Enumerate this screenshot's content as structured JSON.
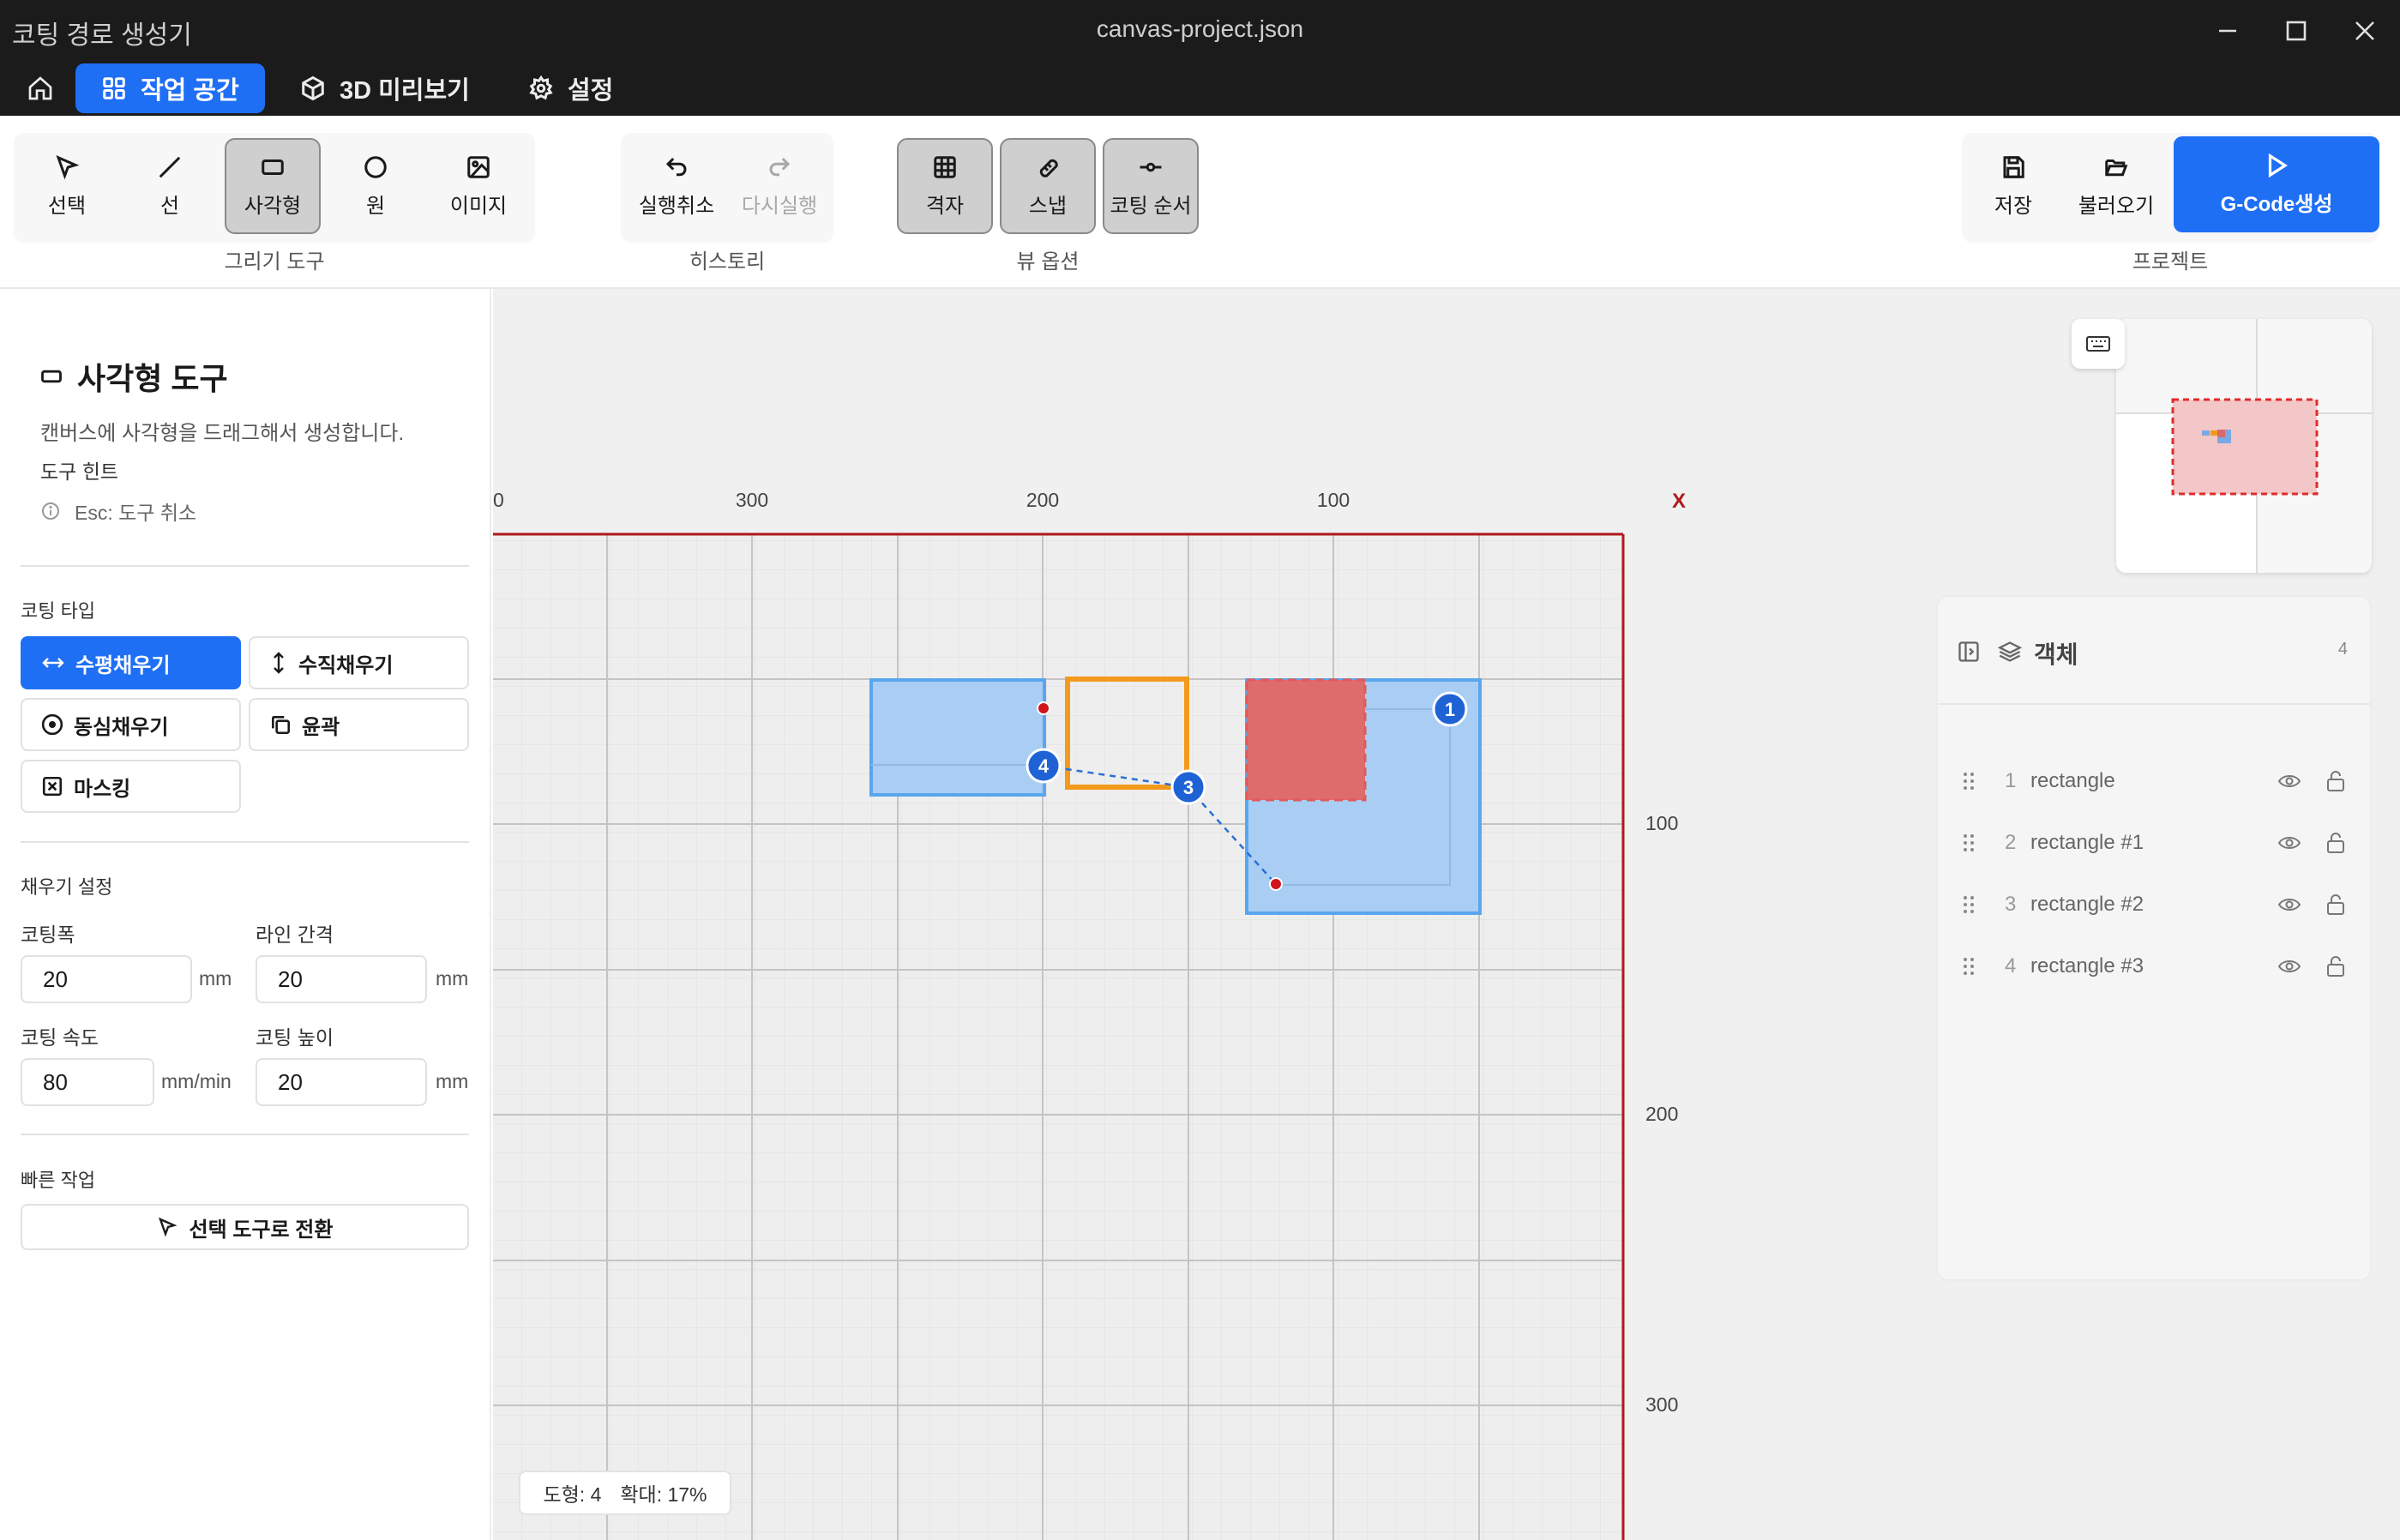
{
  "window": {
    "app_title": "코팅 경로 생성기",
    "file_title": "canvas-project.json"
  },
  "nav": {
    "tabs": [
      {
        "label": "작업 공간",
        "icon": "grid-icon",
        "active": true
      },
      {
        "label": "3D 미리보기",
        "icon": "cube-icon",
        "active": false
      },
      {
        "label": "설정",
        "icon": "gear-icon",
        "active": false
      }
    ]
  },
  "toolbar": {
    "draw_tools": {
      "group_label": "그리기 도구",
      "select": "선택",
      "line": "선",
      "rectangle": "사각형",
      "circle": "원",
      "image": "이미지"
    },
    "history": {
      "group_label": "히스토리",
      "undo": "실행취소",
      "redo": "다시실행"
    },
    "view": {
      "group_label": "뷰 옵션",
      "grid": "격자",
      "snap": "스냅",
      "order": "코팅 순서"
    },
    "project": {
      "group_label": "프로젝트",
      "save": "저장",
      "load": "불러오기",
      "gcode": "G-Code생성"
    }
  },
  "left_panel": {
    "title": "사각형 도구",
    "description": "캔버스에 사각형을 드래그해서 생성합니다.",
    "hint_title": "도구 힌트",
    "hint": "Esc: 도구 취소",
    "coating_type_label": "코팅 타입",
    "coating_types": {
      "horizontal": "수평채우기",
      "vertical": "수직채우기",
      "concentric": "동심채우기",
      "outline": "윤곽",
      "masking": "마스킹"
    },
    "fill_settings_label": "채우기 설정",
    "fields": {
      "width_label": "코팅폭",
      "width_value": "20",
      "width_unit": "mm",
      "spacing_label": "라인 간격",
      "spacing_value": "20",
      "spacing_unit": "mm",
      "speed_label": "코팅 속도",
      "speed_value": "80",
      "speed_unit": "mm/min",
      "height_label": "코팅 높이",
      "height_value": "20",
      "height_unit": "mm"
    },
    "quick_label": "빠른 작업",
    "quick_button": "선택 도구로 전환"
  },
  "canvas": {
    "x_ticks": [
      "0",
      "300",
      "200",
      "100"
    ],
    "x_axis_label": "X",
    "y_ticks": [
      "100",
      "200",
      "300"
    ],
    "markers": [
      "1",
      "3",
      "4"
    ],
    "status": {
      "shapes": "도형: 4",
      "zoom": "확대: 17%"
    }
  },
  "objects_panel": {
    "title": "객체",
    "count": "4",
    "items": [
      {
        "num": "1",
        "name": "rectangle"
      },
      {
        "num": "2",
        "name": "rectangle #1"
      },
      {
        "num": "3",
        "name": "rectangle #2"
      },
      {
        "num": "4",
        "name": "rectangle #3"
      }
    ]
  },
  "colors": {
    "accent": "#1f6ff5",
    "shape_blue": "#a9cdf3",
    "shape_red": "#de6c6c",
    "shape_orange": "#f39a1c",
    "work_border": "#b0181c"
  }
}
